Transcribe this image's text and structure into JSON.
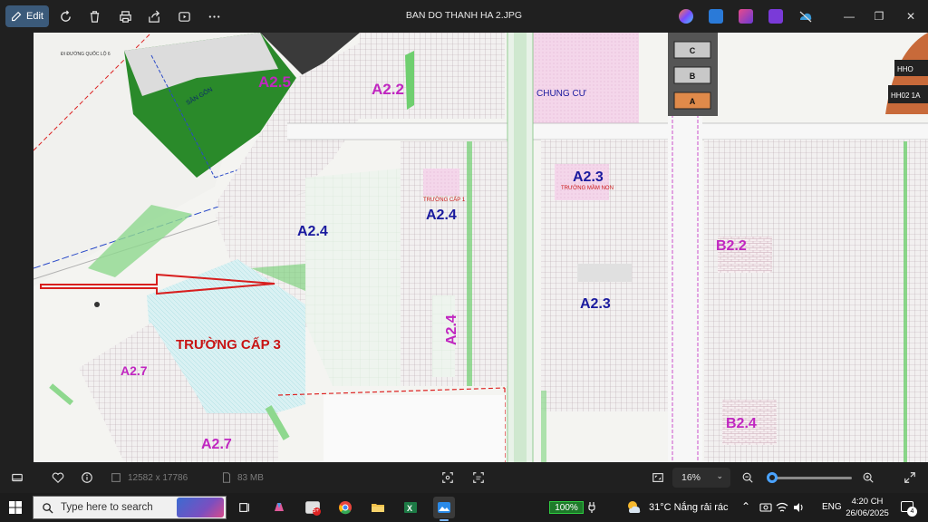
{
  "window": {
    "title": "BAN DO THANH HA 2.JPG",
    "edit_label": "Edit"
  },
  "toolbar_icons": [
    "rotate-icon",
    "delete-icon",
    "print-icon",
    "share-icon",
    "slideshow-icon",
    "more-icon"
  ],
  "map": {
    "road_label": "ĐI ĐƯỜNG QUỐC LỘ 6",
    "golf_label": "SÂN GÔN",
    "apartment_label": "CHUNG CƯ",
    "high_school": "TRƯỜNG CẤP 3",
    "primary_school": "TRƯỜNG CẤP 1",
    "kindergarten": "TRƯỜNG MẦM NON",
    "zones": {
      "a25": "A2.5",
      "a22": "A2.2",
      "a23_top": "A2.3",
      "a23_mid": "A2.3",
      "a24_left": "A2.4",
      "a24_mid": "A2.4",
      "a24_vert": "A2.4",
      "a27_left": "A2.7",
      "a27_bottom": "A2.7",
      "b22": "B2.2",
      "b24": "B2.4",
      "block_c": "C",
      "block_b": "B",
      "block_a": "A",
      "hh02": "HH02 1A",
      "hho": "HHO"
    },
    "colors": {
      "background": "#f4f4f1",
      "zone_pink": "#c026c0",
      "zone_blue": "#1a1a9e",
      "school_red": "#c81414",
      "park_green": "#6fcf6f",
      "arrow_red": "#d81e1e"
    }
  },
  "info": {
    "dimensions": "12582 x 17786",
    "filesize": "83 MB",
    "zoom": "16%",
    "zoom_level": 0.02
  },
  "taskbar": {
    "search_placeholder": "Type here to search",
    "battery": "100%",
    "weather": "31°C  Nắng rải rác",
    "language": "ENG",
    "time": "4:20 CH",
    "date": "26/06/2025",
    "mail_badge": "5+",
    "notifications": "4"
  }
}
